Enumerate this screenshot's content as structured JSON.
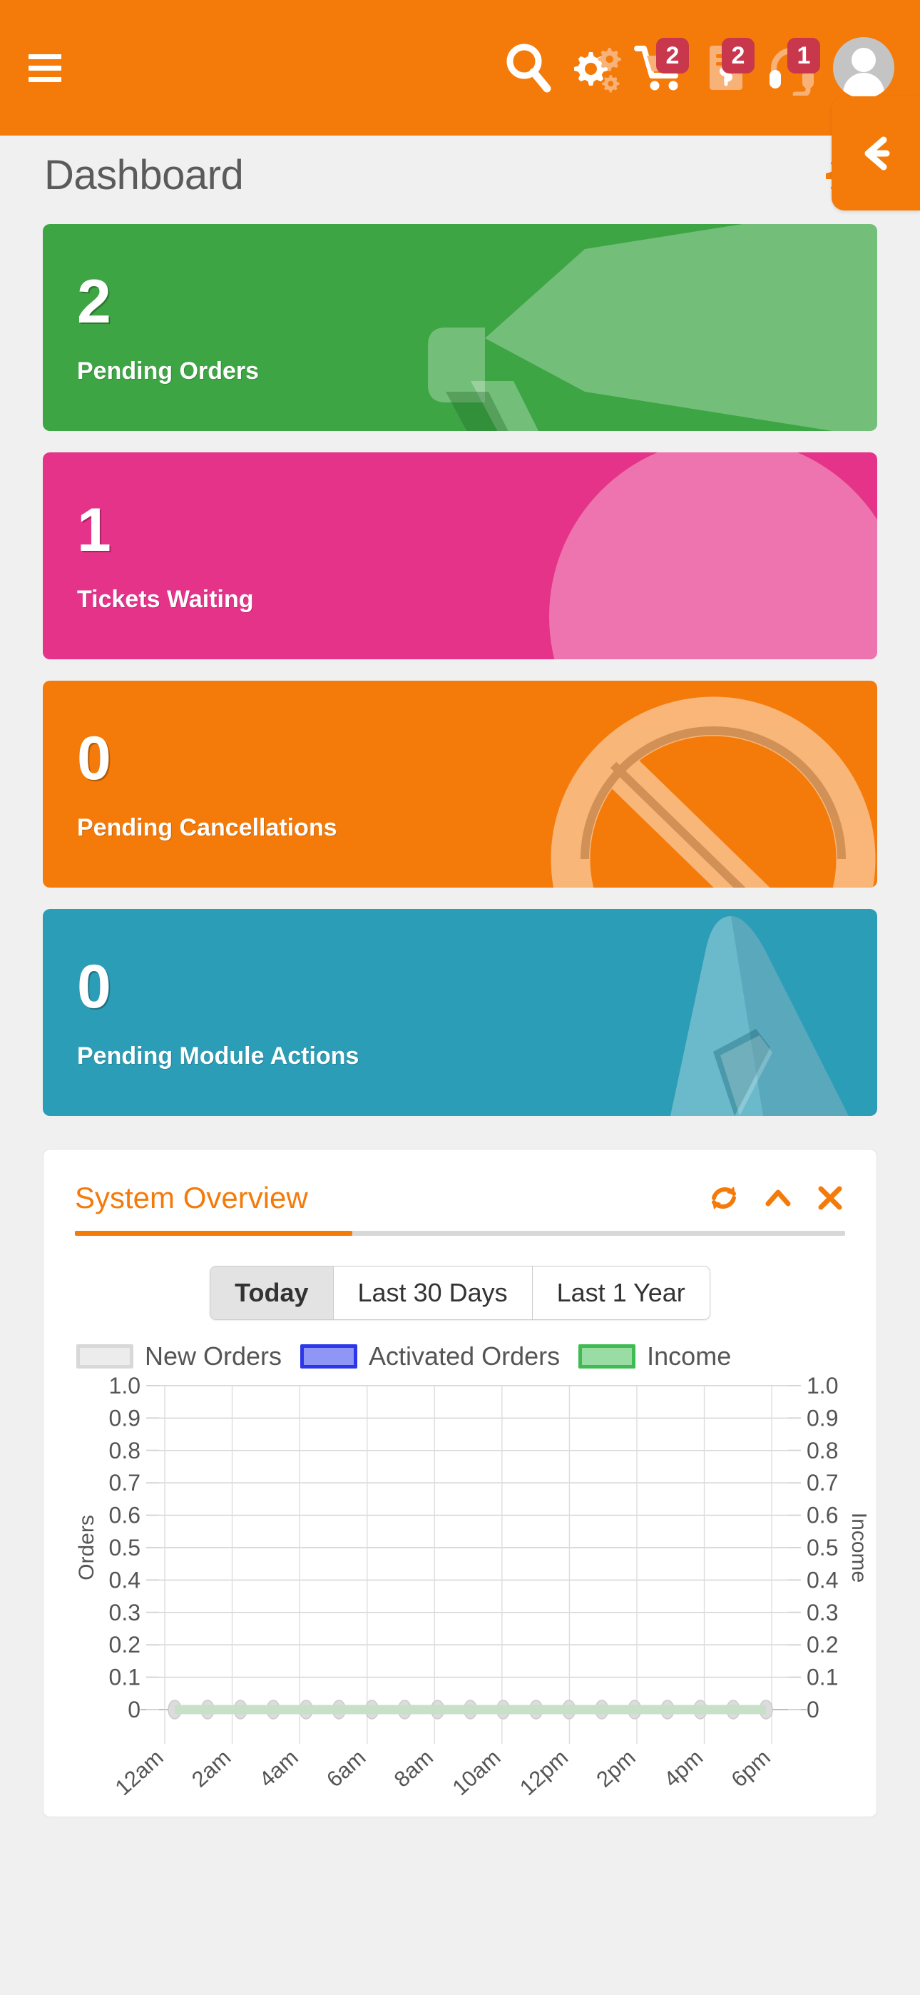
{
  "header": {
    "menu_icon": "hamburger-icon",
    "icons": [
      {
        "name": "search-icon",
        "badge": null
      },
      {
        "name": "gears-icon",
        "badge": null
      },
      {
        "name": "cart-icon",
        "badge": "2"
      },
      {
        "name": "invoice-icon",
        "badge": "2"
      },
      {
        "name": "support-headset-icon",
        "badge": "1"
      }
    ],
    "avatar": "user-avatar",
    "accent": "#F47B0A",
    "badge_color": "#C8374B"
  },
  "page": {
    "title": "Dashboard",
    "settings_icon": "gear-icon",
    "back_icon": "arrow-left-icon"
  },
  "stat_cards": [
    {
      "value": "2",
      "label": "Pending Orders",
      "color": "#3DA544",
      "icon": "megaphone-icon"
    },
    {
      "value": "1",
      "label": "Tickets Waiting",
      "color": "#E5338A",
      "icon": "circle-icon"
    },
    {
      "value": "0",
      "label": "Pending Cancellations",
      "color": "#F47B0A",
      "icon": "ban-icon"
    },
    {
      "value": "0",
      "label": "Pending Module Actions",
      "color": "#2C9DB7",
      "icon": "rocket-icon"
    }
  ],
  "panel": {
    "title": "System Overview",
    "tools": [
      {
        "name": "refresh-icon",
        "label": "↻"
      },
      {
        "name": "collapse-chevron-up-icon",
        "label": "∧"
      },
      {
        "name": "close-icon",
        "label": "✕"
      }
    ],
    "tabs": [
      {
        "label": "Today",
        "active": true
      },
      {
        "label": "Last 30 Days",
        "active": false
      },
      {
        "label": "Last 1 Year",
        "active": false
      }
    ]
  },
  "chart_data": {
    "type": "line",
    "title": "System Overview",
    "xlabel": "",
    "ylabel": "Orders",
    "y2label": "Income",
    "ylim": [
      0,
      1.0
    ],
    "y2lim": [
      0,
      1.0
    ],
    "grid": true,
    "legend_position": "top-left",
    "yticks": [
      "0",
      "0.1",
      "0.2",
      "0.3",
      "0.4",
      "0.5",
      "0.6",
      "0.7",
      "0.8",
      "0.9",
      "1.0"
    ],
    "y2ticks": [
      "0",
      "0.1",
      "0.2",
      "0.3",
      "0.4",
      "0.5",
      "0.6",
      "0.7",
      "0.8",
      "0.9",
      "1.0"
    ],
    "xticks": [
      "12am",
      "2am",
      "4am",
      "6am",
      "8am",
      "10am",
      "12pm",
      "2pm",
      "4pm",
      "6pm"
    ],
    "x": [
      "12am",
      "1am",
      "2am",
      "3am",
      "4am",
      "5am",
      "6am",
      "7am",
      "8am",
      "9am",
      "10am",
      "11am",
      "12pm",
      "1pm",
      "2pm",
      "3pm",
      "4pm",
      "5pm",
      "6pm"
    ],
    "series": [
      {
        "name": "New Orders",
        "color": "#d8d8d8",
        "values": [
          0,
          0,
          0,
          0,
          0,
          0,
          0,
          0,
          0,
          0,
          0,
          0,
          0,
          0,
          0,
          0,
          0,
          0,
          0
        ]
      },
      {
        "name": "Activated Orders",
        "color": "#5b5b5b",
        "values": [
          0,
          0,
          0,
          0,
          0,
          0,
          0,
          0,
          0,
          0,
          0,
          0,
          0,
          0,
          0,
          0,
          0,
          0,
          0
        ]
      },
      {
        "name": "Income",
        "color": "#c8dfc8",
        "values": [
          0,
          0,
          0,
          0,
          0,
          0,
          0,
          0,
          0,
          0,
          0,
          0,
          0,
          0,
          0,
          0,
          0,
          0,
          0
        ]
      }
    ]
  }
}
